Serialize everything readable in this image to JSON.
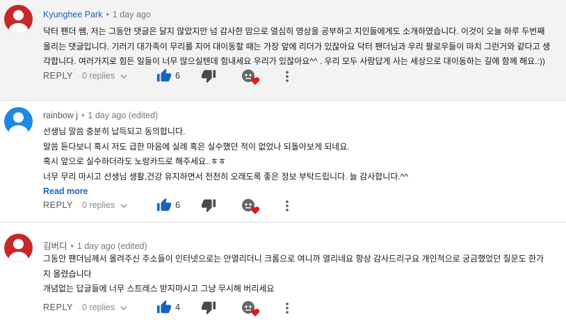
{
  "comments": [
    {
      "author": "Kyunghee Park",
      "time": "1 day ago",
      "text": [
        "닥터 팬더 쌤, 저는 그동안 댓글은 달지 않았지만 넘 감사한 맘으로 열심히 영상을 공부하고 지인들에게도 소개하였습니다. 이것이 오늘 하루 두번째",
        "올리는 댓글입니다. 기러기 대가족이 무리를 지어 대이동할 때는 가장 앞에 리더가 있잖아요 닥터 팬더님과 우리 팔로우들이 마치 그런거와 같다고 생",
        "각합니다. 여러가지로 힘든 일들이 너무 많으실텐데 힘내세요 우리가 있잖아요^^ . 우리 모두 사람답게 사는 세상으로 대이동하는 길에 함께 해요.:))"
      ],
      "reply_label": "REPLY",
      "replies_label": "0 replies",
      "likes": "6"
    },
    {
      "author": "rainbow j",
      "time": "1 day ago (edited)",
      "text": [
        "선생님 말씀 충분히 납득되고 동의합니다.",
        "말씀 듣다보니 혹시 저도 급한 마음에 실례 혹은 실수했던 적이 없었나 되돌아보게 되네요.",
        "혹시 앞으로 실수하더라도 노랑카드로 해주세요..ㅎㅎ",
        "너무 무리 마시고 선생님 생활,건강 유지하면서 천천히 오래도록 좋은 정보 부탁드립니다. 늘 감사합니다.^^"
      ],
      "read_more": "Read more",
      "reply_label": "REPLY",
      "replies_label": "0 replies",
      "likes": "6"
    },
    {
      "author": "김버디",
      "time": "1 day ago (edited)",
      "text": [
        "그동안 팬더님께서 올려주신 주소들이 인터넷으로는 안열리더니 크롬으로 여니까 열리네요 항상 감사드리구요 개인적으로 궁금했었던 질문도 한가",
        "지 올렸습니다",
        "개념없는 답글들에  너무 스트레스 받지마시고 그냥 무시해 버리세요"
      ],
      "reply_label": "REPLY",
      "replies_label": "0 replies",
      "likes": "4"
    }
  ],
  "icons": {
    "like": "thumbs-up-icon",
    "dislike": "thumbs-down-icon",
    "creator_heart": "creator-heart-icon",
    "more": "more-vertical-icon",
    "chevron": "chevron-down-icon"
  },
  "colors": {
    "channel_author": "#1a5fb4",
    "like_blue": "#1565c0",
    "heart_red": "#e01a1a",
    "avatar_red": "#c62828",
    "avatar_blue": "#1e88e5"
  }
}
